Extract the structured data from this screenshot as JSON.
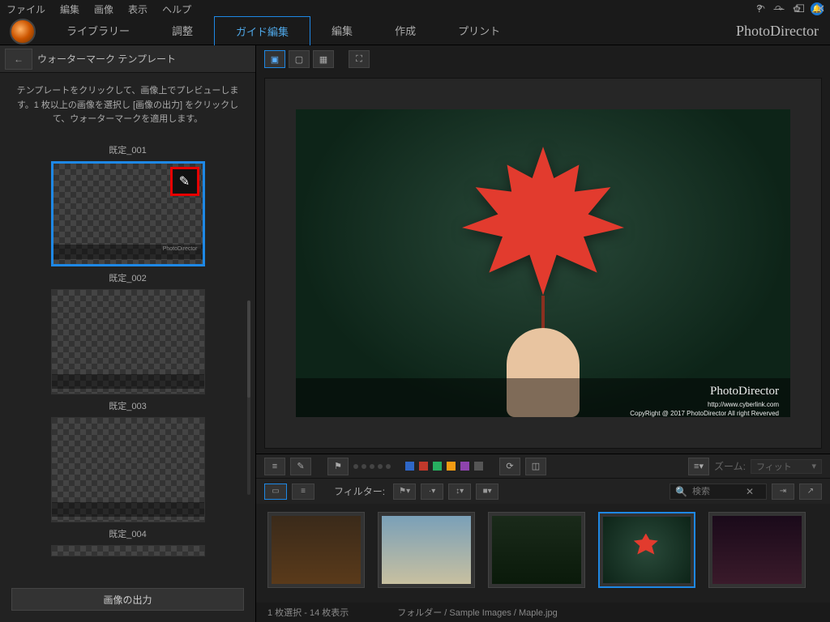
{
  "menus": {
    "file": "ファイル",
    "edit": "編集",
    "image": "画像",
    "view": "表示",
    "help": "ヘルプ"
  },
  "window_controls": {
    "help": "?",
    "min": "—",
    "max": "☐",
    "close": "✕"
  },
  "appname": "PhotoDirector",
  "tabs": {
    "library": "ライブラリー",
    "adjust": "調整",
    "guided": "ガイド編集",
    "edit": "編集",
    "create": "作成",
    "print": "プリント"
  },
  "left": {
    "title": "ウォーターマーク テンプレート",
    "desc": "テンプレートをクリックして、画像上でプレビューします。1 枚以上の画像を選択し [画像の出力] をクリックして、ウォーターマークを適用します。",
    "templates": [
      "既定_001",
      "既定_002",
      "既定_003",
      "既定_004"
    ],
    "wm_small": "PhotoDirector",
    "export": "画像の出力"
  },
  "view_toolbar": {
    "single": "▣",
    "compare": "▢",
    "grid": "▦",
    "fullscreen": "⛶"
  },
  "watermark": {
    "title": "PhotoDirector",
    "url": "http://www.cyberlink.com",
    "copyright": "CopyRight @ 2017 PhotoDirector All right Reverved"
  },
  "midbar": {
    "colors": [
      "#2e67c7",
      "#c0392b",
      "#27ae60",
      "#f39c12",
      "#8e44ad",
      "#555"
    ],
    "zoom_label": "ズーム:",
    "zoom_value": "フィット"
  },
  "browser": {
    "filter": "フィルター:",
    "search_placeholder": "検索"
  },
  "status": {
    "selection": "1 枚選択 - 14 枚表示",
    "path": "フォルダー / Sample Images / Maple.jpg"
  }
}
